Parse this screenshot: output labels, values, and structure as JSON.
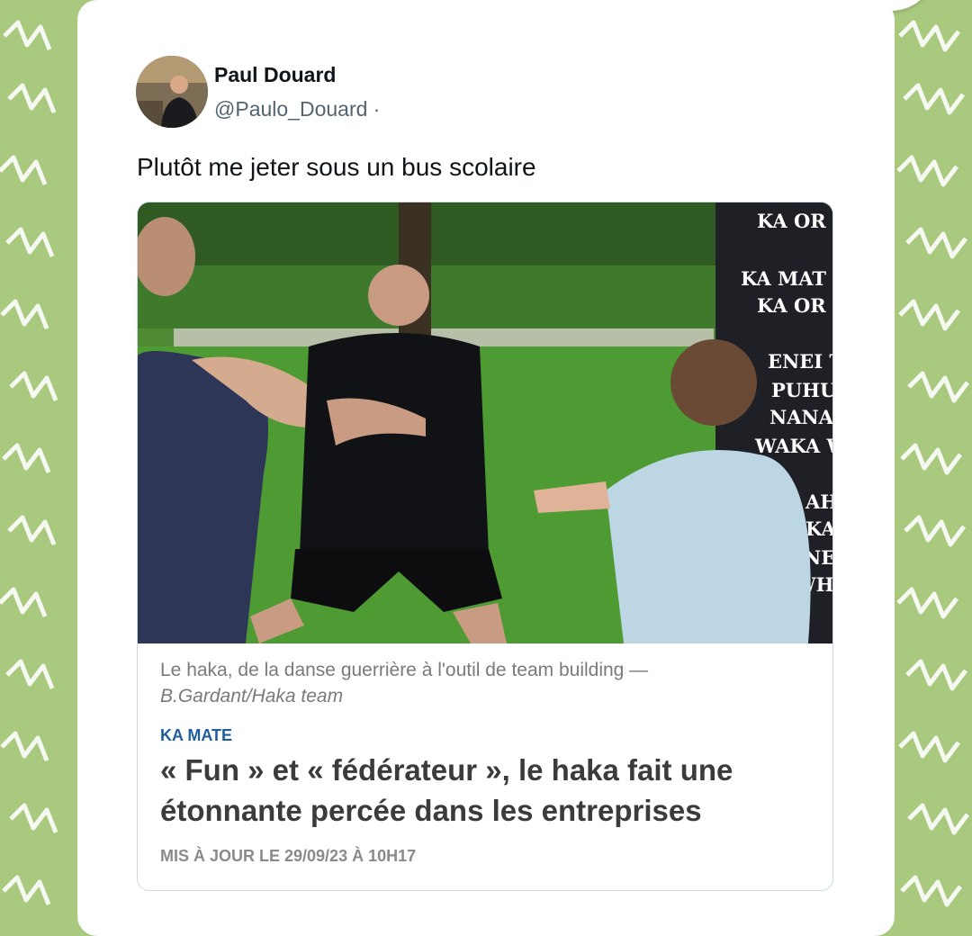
{
  "tweet": {
    "author_name": "Paul Douard",
    "author_handle": "@Paulo_Douard ·",
    "text": "Plutôt me jeter sous un bus scolaire"
  },
  "article": {
    "photo_sign_lines": [
      "KA OR",
      "KA MAT",
      "KA OR",
      "ENEI T",
      "PUHU",
      "NANA",
      "WAKA W",
      "AH",
      "KA",
      "NE",
      "WHI"
    ],
    "caption": "Le haka, de la danse guerrière à l'outil de team building —",
    "caption_credit": "B.Gardant/Haka team",
    "kicker": "KA MATE",
    "headline": "« Fun » et « fédérateur », le haka fait une étonnante percée dans les entreprises",
    "updated": "MIS À JOUR LE 29/09/23 À 10H17"
  },
  "colors": {
    "background": "#a9c97f",
    "kicker": "#1f5d9c",
    "headline": "#3b3b3b"
  }
}
